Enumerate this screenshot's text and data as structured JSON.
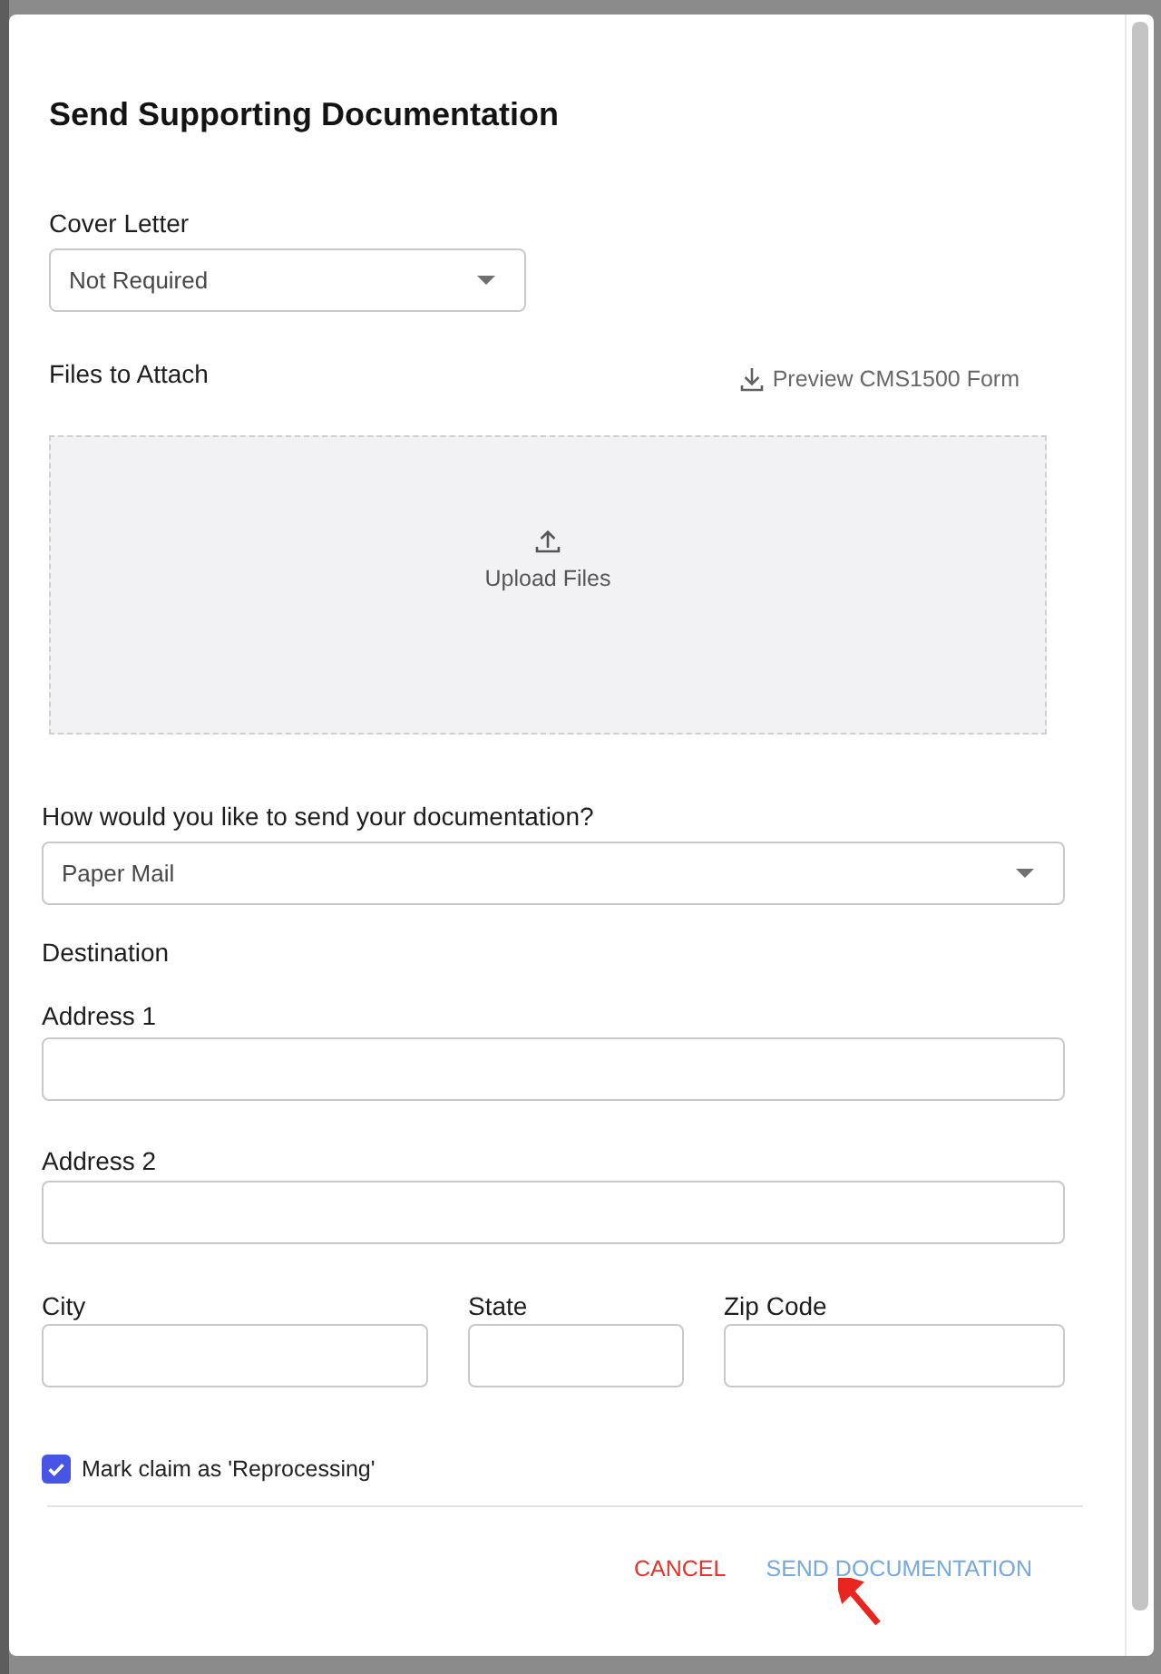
{
  "dialog": {
    "title": "Send Supporting Documentation"
  },
  "cover_letter": {
    "label": "Cover Letter",
    "value": "Not Required"
  },
  "files": {
    "label": "Files to Attach",
    "preview_link": "Preview CMS1500 Form",
    "upload_label": "Upload Files"
  },
  "delivery": {
    "label": "How would you like to send your documentation?",
    "value": "Paper Mail"
  },
  "destination": {
    "heading": "Destination",
    "address_lines": [
      {
        "label": "Address 1"
      },
      {
        "label": "Address 2"
      }
    ],
    "locality": [
      {
        "label": "City"
      },
      {
        "label": "State"
      },
      {
        "label": "Zip Code"
      }
    ]
  },
  "reprocessing": {
    "label": "Mark claim as 'Reprocessing'",
    "checked": true
  },
  "buttons": [
    {
      "label": "CANCEL",
      "kind": "cancel"
    },
    {
      "label": "SEND DOCUMENTATION",
      "kind": "primary"
    }
  ]
}
